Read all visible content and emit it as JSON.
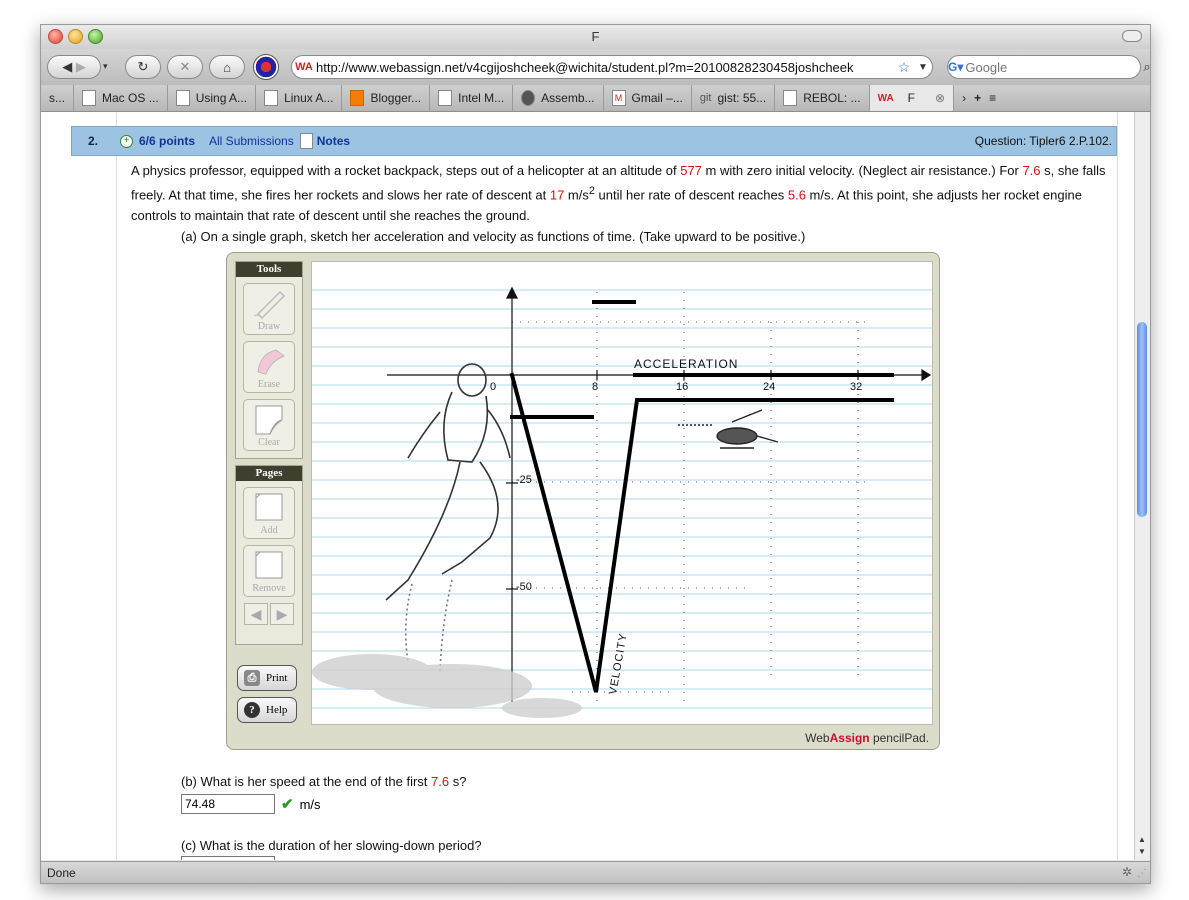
{
  "window": {
    "title": "F"
  },
  "toolbar": {
    "url": "http://www.webassign.net/v4cgijoshcheek@wichita/student.pl?m=20100828230458joshcheek",
    "search_placeholder": "Google"
  },
  "bookmarks": [
    {
      "label": "s...",
      "icon": "back-chevron"
    },
    {
      "label": "Mac OS ...",
      "icon": "apple-icon"
    },
    {
      "label": "Using A...",
      "icon": "page-icon"
    },
    {
      "label": "Linux A...",
      "icon": "page-icon"
    },
    {
      "label": "Blogger...",
      "icon": "blogger-icon"
    },
    {
      "label": "Intel M...",
      "icon": "page-icon"
    },
    {
      "label": "Assemb...",
      "icon": "page-icon"
    },
    {
      "label": "Gmail –...",
      "icon": "gmail-icon"
    },
    {
      "label": "gist: 55...",
      "icon": "git-icon"
    },
    {
      "label": "REBOL: ...",
      "icon": "page-icon"
    },
    {
      "label": "F",
      "icon": "webassign-icon"
    }
  ],
  "question": {
    "number": "2.",
    "points": "6/6 points",
    "all_submissions": "All Submissions",
    "notes": "Notes",
    "reference": "Question: Tipler6 2.P.102.",
    "text_1": "A physics professor, equipped with a rocket backpack, steps out of a helicopter at an altitude of ",
    "altitude": "577",
    "text_2": " m with zero initial velocity. (Neglect air resistance.) For ",
    "time": "7.6",
    "text_3": " s, she falls freely. At that time, she fires her rockets and slows her rate of descent at ",
    "decel": "17",
    "text_4": " m/s",
    "text_4_sup": "2",
    "text_5": " until her rate of descent reaches ",
    "final_speed": "5.6",
    "text_6": " m/s. At this point, she adjusts her rocket engine controls to maintain that rate of descent until she reaches the ground.",
    "part_a": "(a) On a single graph, sketch her acceleration and velocity as functions of time. (Take upward to be positive.)",
    "part_b_1": "(b) What is her speed at the end of the first ",
    "part_b_time": "7.6",
    "part_b_2": " s?",
    "part_b_answer": "74.48",
    "part_b_unit": "m/s",
    "part_c": "(c) What is the duration of her slowing-down period?"
  },
  "pencilpad": {
    "tools_title": "Tools",
    "draw": "Draw",
    "erase": "Erase",
    "clear": "Clear",
    "pages_title": "Pages",
    "add": "Add",
    "remove": "Remove",
    "print": "Print",
    "help": "Help",
    "brand_a": "Web",
    "brand_b": "Assign",
    "brand_c": " pencilPad.",
    "graph": {
      "x_ticks": [
        "0",
        "8",
        "16",
        "24",
        "32"
      ],
      "y_ticks": [
        "-25",
        "-50"
      ],
      "acceleration_label": "ACCELERATION",
      "velocity_label": "VELOCITY"
    }
  },
  "status": {
    "text": "Done"
  }
}
